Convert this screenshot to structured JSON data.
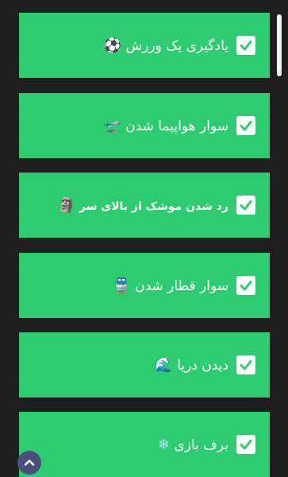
{
  "items": [
    {
      "label": "یادگیری یک ورزش",
      "emoji": "⚽",
      "checked": true
    },
    {
      "label": "سوار هواپیما شدن",
      "emoji": "🛫",
      "checked": true
    },
    {
      "label": "رد شدن موشک از بالای سر",
      "emoji": "🗿",
      "checked": true
    },
    {
      "label": "سوار قطار شدن",
      "emoji": "🚆",
      "checked": true
    },
    {
      "label": "دیدن دریا",
      "emoji": "🌊",
      "checked": true
    },
    {
      "label": "برف بازی",
      "emoji": "❄",
      "checked": true
    }
  ],
  "colors": {
    "card": "#2ecc71",
    "background": "#1e1e1e",
    "check": "#2ecc71",
    "scroll_button": "#4b4e7a"
  }
}
